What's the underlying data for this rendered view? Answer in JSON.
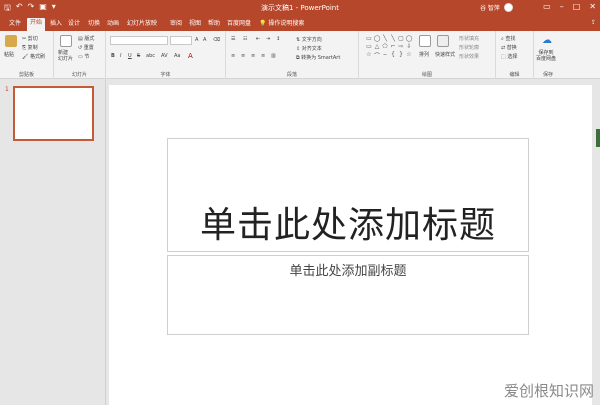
{
  "window": {
    "title": "演示文稿1 - PowerPoint",
    "user": "谷 智萍",
    "share_icon": "share-icon",
    "accent": "#b7472a"
  },
  "tabs": [
    "文件",
    "开始",
    "插入",
    "设计",
    "切换",
    "动画",
    "幻灯片放映",
    "审阅",
    "视图",
    "帮助",
    "百度网盘"
  ],
  "tell_me": "操作说明搜索",
  "ribbon": {
    "clipboard": {
      "label": "剪贴板",
      "paste": "粘贴",
      "cut": "剪切",
      "copy": "复制",
      "format": "格式刷"
    },
    "slides": {
      "label": "幻灯片",
      "new_slide": "新建\n幻灯片",
      "layout": "版式",
      "reset": "重置",
      "section": "节"
    },
    "font": {
      "label": "字体",
      "bold": "B",
      "italic": "I",
      "underline": "U",
      "strike": "S",
      "shadow": "abc",
      "spacing": "AV",
      "case": "Aa",
      "grow": "A",
      "shrink": "A"
    },
    "paragraph": {
      "label": "段落",
      "text_direction": "文字方向",
      "align_text": "对齐文本",
      "smartart": "转换为 SmartArt"
    },
    "drawing": {
      "label": "绘图",
      "arrange": "排列",
      "quick_styles": "快速样式",
      "shape_fill": "形状填充",
      "shape_outline": "形状轮廓",
      "shape_effects": "形状效果",
      "shapes": [
        "▭",
        "◯",
        "╲",
        "╲",
        "▢",
        "◯",
        "▭",
        "△",
        "⬠",
        "⌐",
        "⇨",
        "⇩",
        "☆",
        "⌒",
        "⌢",
        "{",
        "}",
        "☆"
      ]
    },
    "editing": {
      "label": "编辑",
      "find": "查找",
      "replace": "替换",
      "select": "选择"
    },
    "save": {
      "label": "保存",
      "save_to_baidu": "保存到\n百度网盘"
    }
  },
  "slide": {
    "number": "1",
    "title_placeholder": "单击此处添加标题",
    "subtitle_placeholder": "单击此处添加副标题"
  },
  "watermark": "爱创根知识网"
}
